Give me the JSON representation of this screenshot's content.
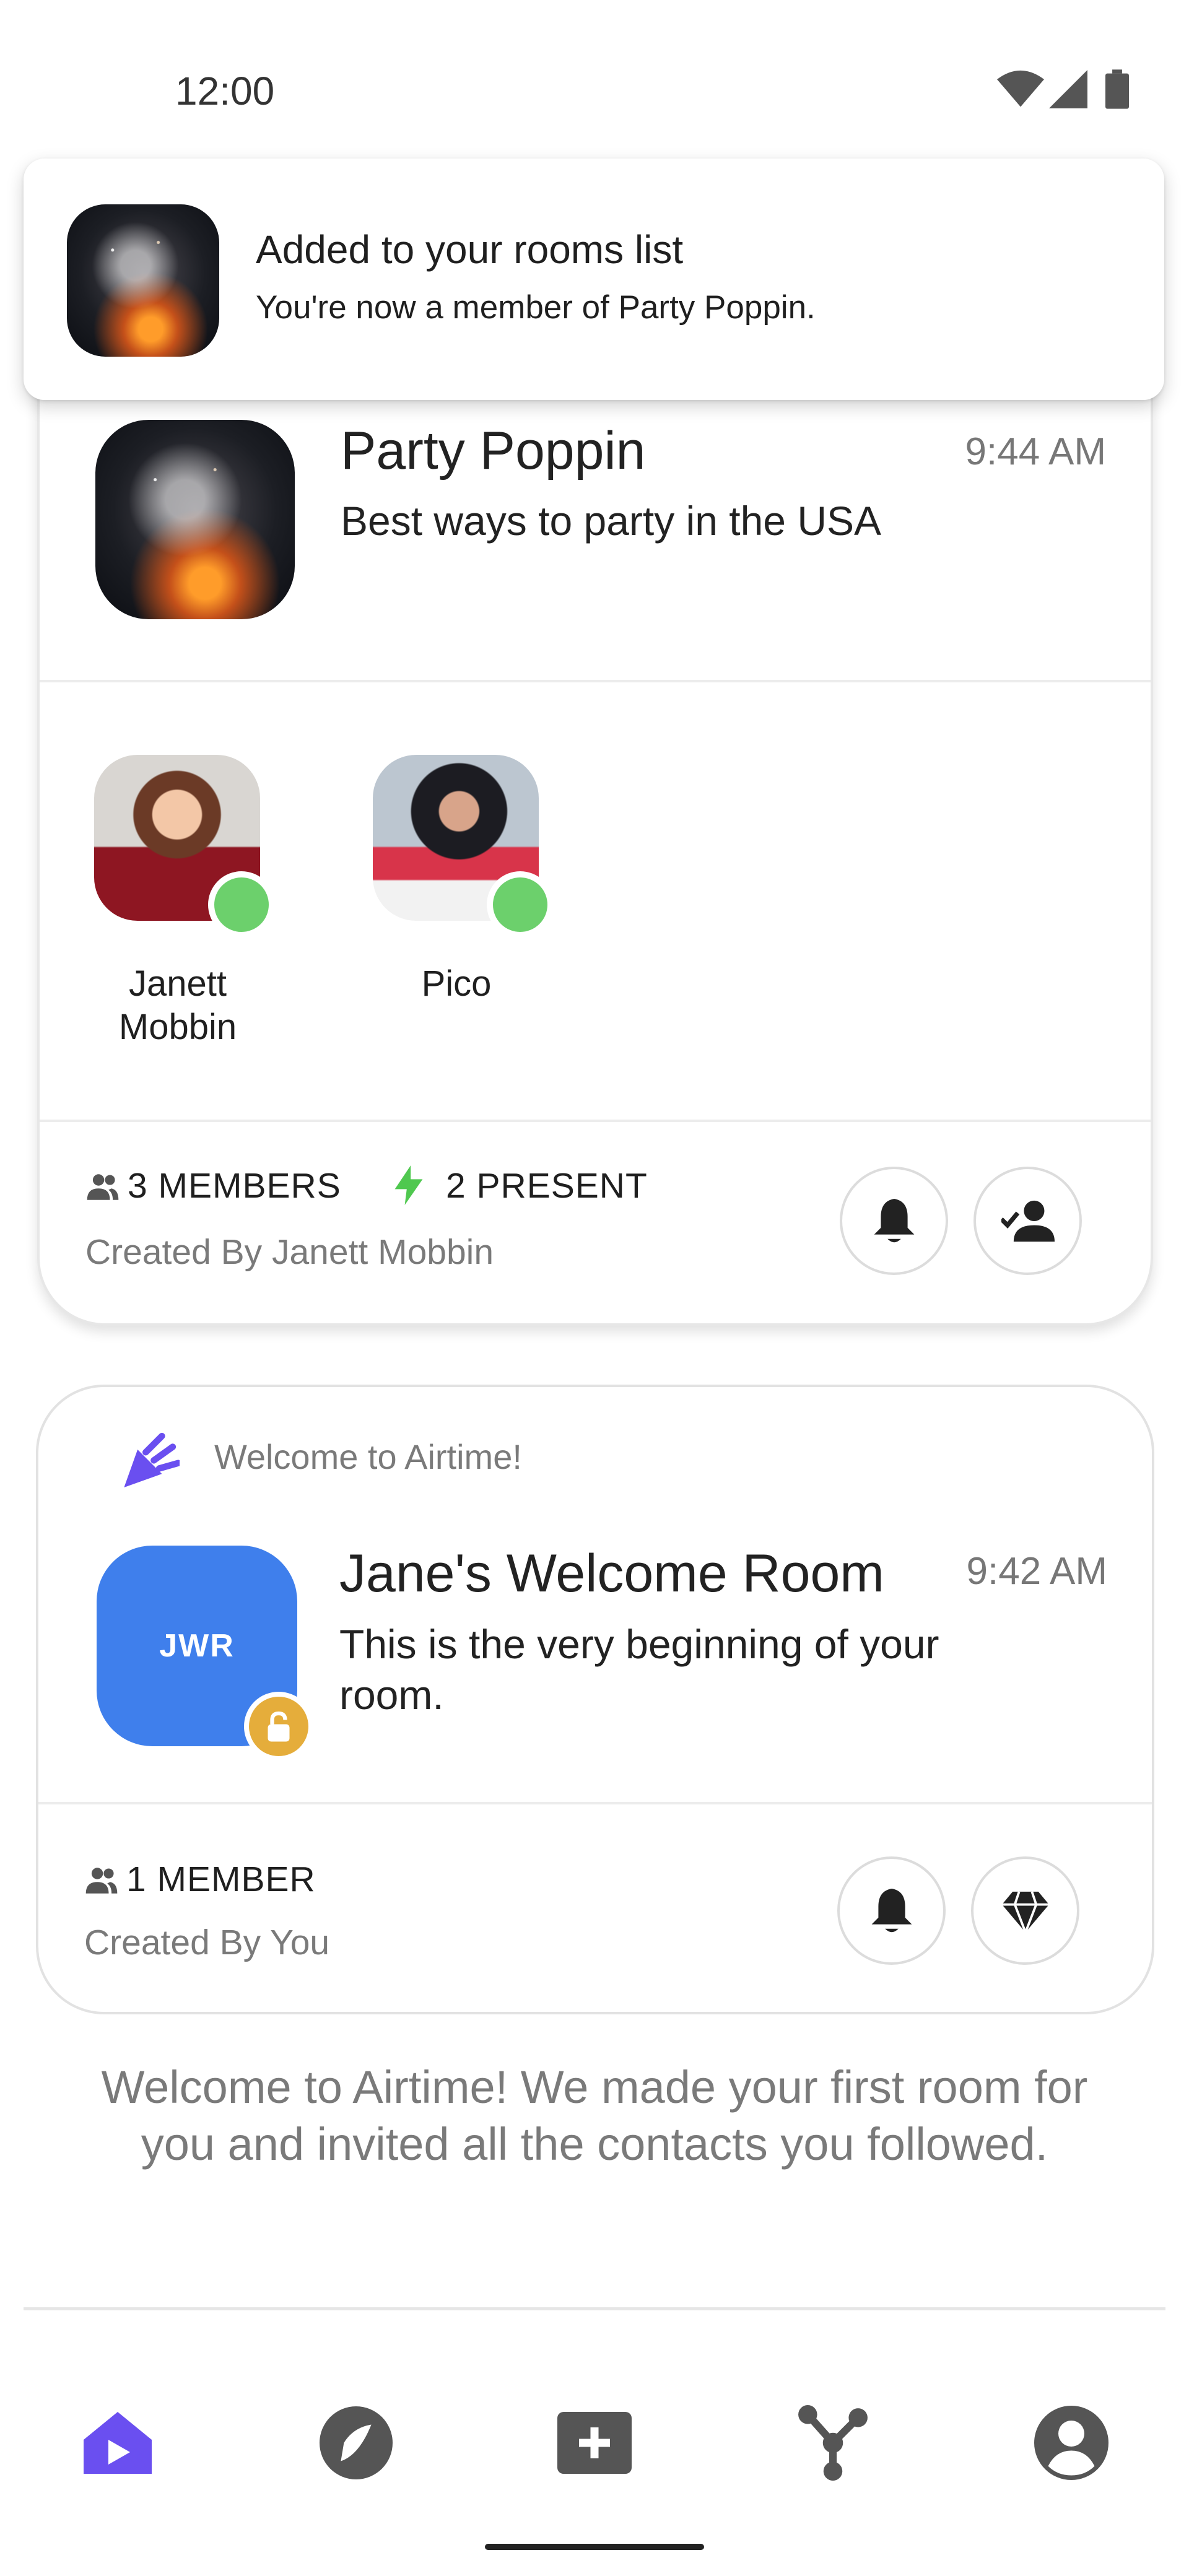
{
  "status_bar": {
    "time": "12:00",
    "icons": [
      "wifi-icon",
      "signal-icon",
      "battery-icon"
    ]
  },
  "toast": {
    "title": "Added to your rooms list",
    "message": "You're now a member of Party Poppin."
  },
  "rooms": [
    {
      "name": "Party Poppin",
      "time": "9:44 AM",
      "description": "Best ways to party in the USA",
      "members": [
        {
          "name_line1": "Janett",
          "name_line2": "Mobbin",
          "status": "online"
        },
        {
          "name_line1": "Pico",
          "name_line2": "",
          "status": "online"
        }
      ],
      "member_count": "3 MEMBERS",
      "present_count": "2 PRESENT",
      "created_by": "Created By Janett Mobbin"
    },
    {
      "banner": "Welcome to Airtime!",
      "name": "Jane's Welcome Room",
      "time": "9:42 AM",
      "description": "This is the very beginning of your room.",
      "avatar_initials": "JWR",
      "member_count": "1 MEMBER",
      "created_by": "Created By You"
    }
  ],
  "welcome_message": "Welcome to Airtime! We made your first room for you and invited all the contacts you followed.",
  "bottom_nav": [
    {
      "name": "home",
      "icon": "home-icon",
      "active": true
    },
    {
      "name": "explore",
      "icon": "compass-icon",
      "active": false
    },
    {
      "name": "create",
      "icon": "add-box-icon",
      "active": false
    },
    {
      "name": "connections",
      "icon": "share-network-icon",
      "active": false
    },
    {
      "name": "profile",
      "icon": "account-circle-icon",
      "active": false
    }
  ],
  "colors": {
    "accent": "#6a4ff0",
    "online": "#6cd06c",
    "bolt": "#4fc84f",
    "room_avatar": "#3f7fec",
    "lock_badge": "#e5ad3b",
    "icon_gray": "#555555"
  }
}
